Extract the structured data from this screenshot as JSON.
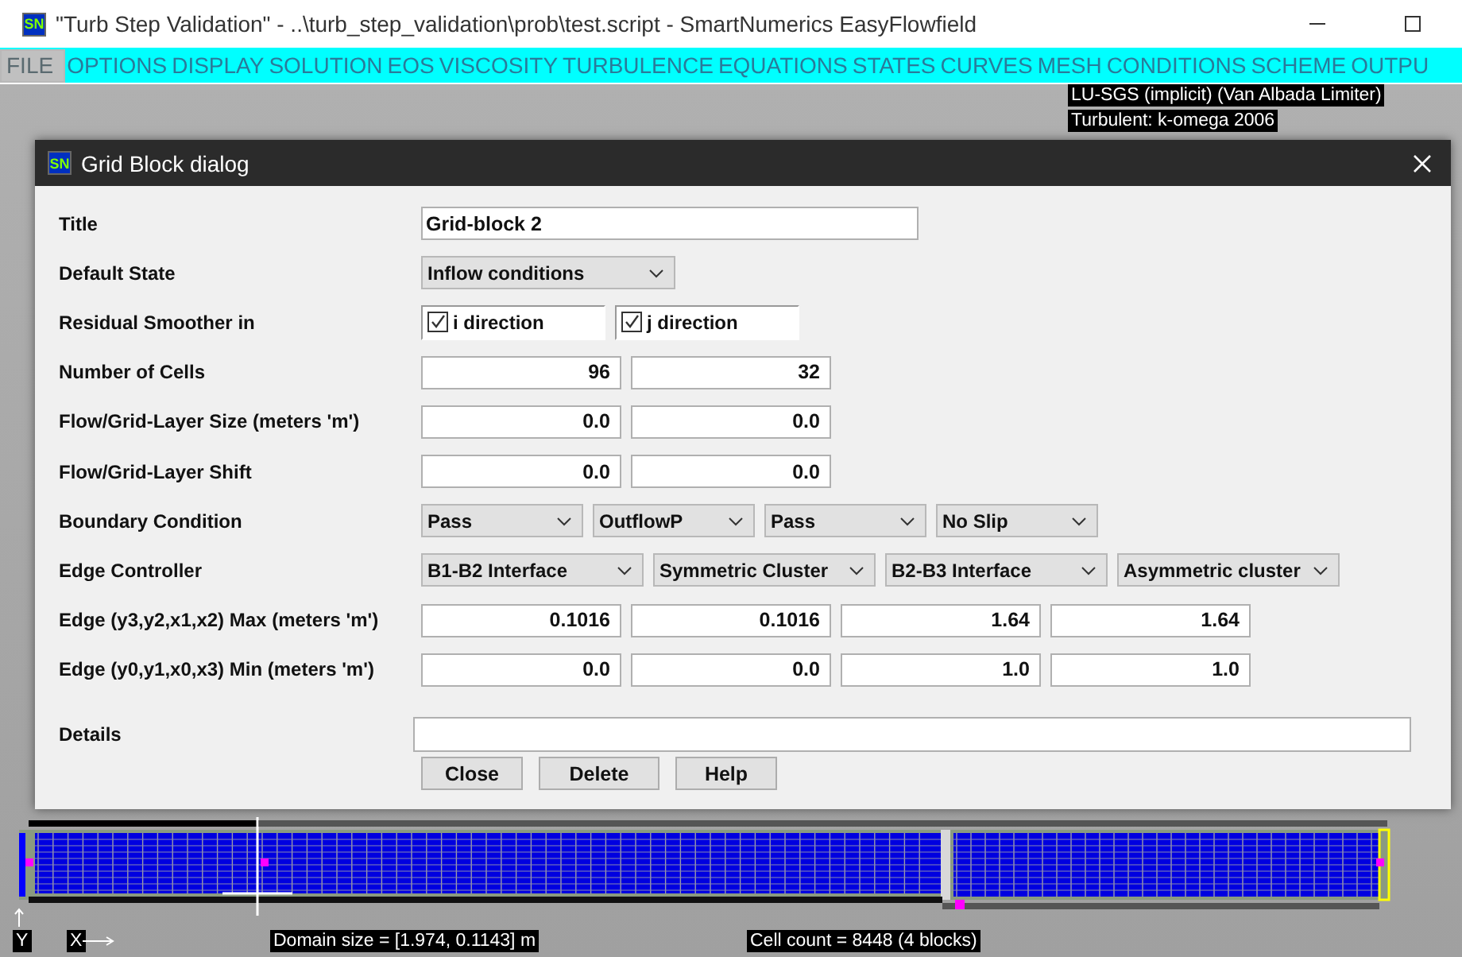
{
  "window": {
    "logo": "SN",
    "title": "\"Turb Step Validation\" - ..\\turb_step_validation\\prob\\test.script - SmartNumerics EasyFlowfield"
  },
  "menu": [
    {
      "label": "FILE",
      "selected": true
    },
    {
      "label": "OPTIONS",
      "selected": false
    },
    {
      "label": "DISPLAY",
      "selected": false
    },
    {
      "label": "SOLUTION",
      "selected": false
    },
    {
      "label": "EOS",
      "selected": false
    },
    {
      "label": "VISCOSITY",
      "selected": false
    },
    {
      "label": "TURBULENCE",
      "selected": false
    },
    {
      "label": "EQUATIONS",
      "selected": false
    },
    {
      "label": "STATES",
      "selected": false
    },
    {
      "label": "CURVES",
      "selected": false
    },
    {
      "label": "MESH",
      "selected": false
    },
    {
      "label": "CONDITIONS",
      "selected": false
    },
    {
      "label": "SCHEME",
      "selected": false
    },
    {
      "label": "OUTPU",
      "selected": false
    }
  ],
  "info": [
    "LU-SGS (implicit) (Van Albada Limiter)",
    "Turbulent: k-omega 2006"
  ],
  "dialog": {
    "logo": "SN",
    "title": "Grid Block dialog",
    "rows": [
      {
        "label": "Title",
        "kind": "text",
        "values": [
          "Grid-block 2"
        ]
      },
      {
        "label": "Default State",
        "kind": "select",
        "values": [
          "Inflow conditions"
        ]
      },
      {
        "label": "Residual Smoother in",
        "kind": "check",
        "values": [
          {
            "label": "i direction",
            "checked": true
          },
          {
            "label": "j direction",
            "checked": true
          }
        ]
      },
      {
        "label": "Number of Cells",
        "kind": "number",
        "values": [
          "96",
          "32"
        ]
      },
      {
        "label": "Flow/Grid-Layer Size (meters 'm')",
        "kind": "number",
        "values": [
          "0.0",
          "0.0"
        ]
      },
      {
        "label": "Flow/Grid-Layer Shift",
        "kind": "number",
        "values": [
          "0.0",
          "0.0"
        ]
      },
      {
        "label": "Boundary Condition",
        "kind": "select",
        "values": [
          "Pass",
          "OutflowP",
          "Pass",
          "No Slip"
        ]
      },
      {
        "label": "Edge Controller",
        "kind": "select",
        "values": [
          "B1-B2 Interface",
          "Symmetric Cluster",
          "B2-B3 Interface",
          "Asymmetric cluster"
        ]
      },
      {
        "label": "Edge (y3,y2,x1,x2) Max (meters 'm')",
        "kind": "number",
        "values": [
          "0.1016",
          "0.1016",
          "1.64",
          "1.64"
        ]
      },
      {
        "label": "Edge (y0,y1,x0,x3) Min (meters 'm')",
        "kind": "number",
        "values": [
          "0.0",
          "0.0",
          "1.0",
          "1.0"
        ]
      }
    ],
    "details": {
      "label": "Details"
    },
    "buttons": [
      "Close",
      "Delete",
      "Help"
    ]
  },
  "canvas": {
    "axes": [
      "Y",
      "X"
    ],
    "domain": "Domain size = [1.974, 0.1143] m",
    "cell_count": "Cell count = 8448 (4 blocks)"
  }
}
